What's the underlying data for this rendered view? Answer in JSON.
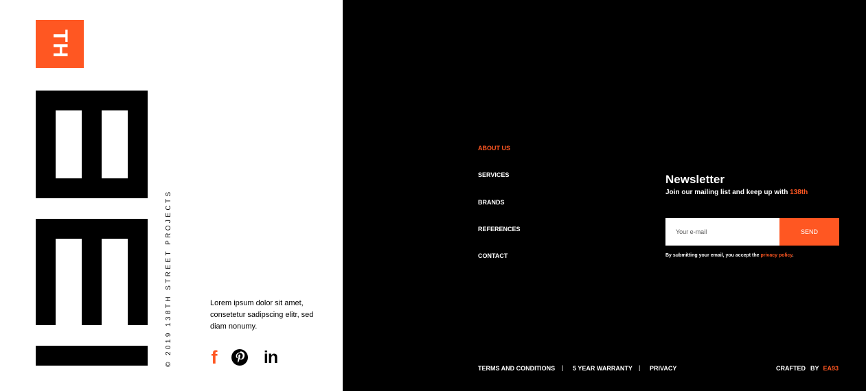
{
  "brand": {
    "badge_text": "TH",
    "tagline_vertical": "© 2019 138TH STREET PROJECTS",
    "accent_color": "#ff5722"
  },
  "about": {
    "text": "Lorem ipsum dolor sit amet, consetetur sadipscing elitr, sed diam nonumy."
  },
  "social": [
    {
      "name": "facebook",
      "glyph": "f",
      "color": "#ff5722"
    },
    {
      "name": "pinterest",
      "color": "#000000"
    },
    {
      "name": "linkedin",
      "glyph": "in",
      "color": "#000000"
    }
  ],
  "nav": {
    "items": [
      {
        "label": "ABOUT US",
        "active": true
      },
      {
        "label": "SERVICES",
        "active": false
      },
      {
        "label": "BRANDS",
        "active": false
      },
      {
        "label": "REFERENCES",
        "active": false
      },
      {
        "label": "CONTACT",
        "active": false
      }
    ]
  },
  "newsletter": {
    "title": "Newsletter",
    "subtitle_prefix": "Join our mailing list and keep up with ",
    "subtitle_highlight": "138th",
    "email_placeholder": "Your e-mail",
    "email_value": "",
    "send_label": "SEND",
    "consent_prefix": "By submitting your email, you accept the ",
    "consent_link": "privacy policy",
    "consent_suffix": "."
  },
  "footer": {
    "links": [
      "TERMS AND CONDITIONS",
      "5 YEAR WARRANTY",
      "PRIVACY"
    ],
    "separator": "|",
    "crafted_label": "CRAFTED",
    "by_label": "BY",
    "agency": "EA93"
  }
}
